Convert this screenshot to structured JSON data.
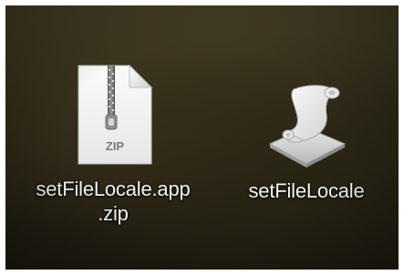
{
  "desktop": {
    "icons": [
      {
        "name": "setFileLocale.app.zip",
        "label_line1": "setFileLocale.app",
        "label_line2": ".zip",
        "badge": "ZIP",
        "icon": "zip-archive-icon"
      },
      {
        "name": "setFileLocale",
        "label": "setFileLocale",
        "icon": "script-scroll-icon"
      }
    ]
  },
  "colors": {
    "label_text": "#f4f4f4",
    "wallpaper_dark": "#1e1b10",
    "wallpaper_light": "#4a4128"
  }
}
